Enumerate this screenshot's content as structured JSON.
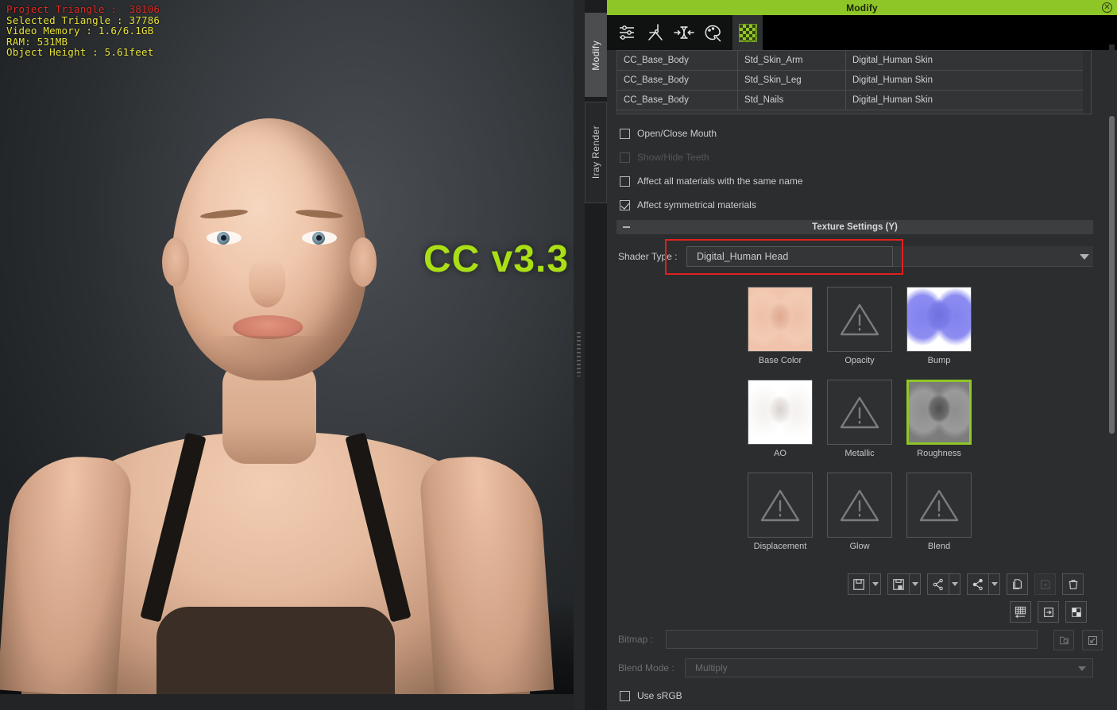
{
  "viewport": {
    "stats": {
      "project_triangle": "Project Triangle :  38106",
      "selected_triangle": "Selected Triangle : 37786",
      "video_memory": "Video Memory : 1.6/6.1GB",
      "ram": "RAM: 531MB",
      "object_height": "Object Height : 5.61feet"
    },
    "watermark": "CC v3.3",
    "colors": {
      "stats_red": "#e02b22",
      "stats_yellow": "#e8e43a",
      "watermark": "#aadf15"
    }
  },
  "vertical_tabs": [
    {
      "label": "Modify",
      "active": true
    },
    {
      "label": "Iray Render",
      "active": false
    }
  ],
  "panel": {
    "title": "Modify",
    "close_icon": "close-icon",
    "title_color": "#8ec628",
    "toolbar": {
      "icons": [
        {
          "name": "sliders-icon",
          "title": "Adjust"
        },
        {
          "name": "pose-icon",
          "title": "Pose"
        },
        {
          "name": "shape-icon",
          "title": "Shape"
        },
        {
          "name": "palette-icon",
          "title": "Appearance"
        }
      ],
      "active_tab": {
        "name": "material-checker-tab",
        "title": "Material"
      }
    },
    "material_table": {
      "rows": [
        {
          "object": "CC_Base_Body",
          "material": "Std_Skin_Arm",
          "shader": "Digital_Human Skin"
        },
        {
          "object": "CC_Base_Body",
          "material": "Std_Skin_Leg",
          "shader": "Digital_Human Skin"
        },
        {
          "object": "CC_Base_Body",
          "material": "Std_Nails",
          "shader": "Digital_Human Skin"
        }
      ]
    },
    "checkboxes": [
      {
        "label": "Open/Close Mouth",
        "checked": false,
        "disabled": false
      },
      {
        "label": "Show/Hide Teeth",
        "checked": false,
        "disabled": true
      },
      {
        "label": "Affect all materials with the same name",
        "checked": false,
        "disabled": false
      },
      {
        "label": "Affect symmetrical materials",
        "checked": true,
        "disabled": false
      }
    ],
    "texture_settings": {
      "header": "Texture Settings  (Y)",
      "collapse_icon": "minus-icon",
      "shader_type_label": "Shader Type :",
      "shader_type_value": "Digital_Human Head",
      "highlight_color": "#e02020",
      "slots": [
        {
          "label": "Base Color",
          "state": "filled",
          "style": "tx-base",
          "selected": false
        },
        {
          "label": "Opacity",
          "state": "empty",
          "style": "",
          "selected": false
        },
        {
          "label": "Bump",
          "state": "filled",
          "style": "tx-bump",
          "selected": false
        },
        {
          "label": "AO",
          "state": "filled",
          "style": "tx-ao",
          "selected": false
        },
        {
          "label": "Metallic",
          "state": "empty",
          "style": "",
          "selected": false
        },
        {
          "label": "Roughness",
          "state": "filled",
          "style": "tx-rough",
          "selected": true
        },
        {
          "label": "Displacement",
          "state": "empty",
          "style": "",
          "selected": false
        },
        {
          "label": "Glow",
          "state": "empty",
          "style": "",
          "selected": false
        },
        {
          "label": "Blend",
          "state": "empty",
          "style": "",
          "selected": false
        }
      ],
      "action_buttons_row1": [
        {
          "name": "save-button",
          "has_caret": true,
          "disabled": false
        },
        {
          "name": "save-as-button",
          "has_caret": true,
          "disabled": false
        },
        {
          "name": "share-button",
          "has_caret": true,
          "disabled": false
        },
        {
          "name": "share-all-button",
          "has_caret": true,
          "disabled": false
        },
        {
          "name": "copy-button",
          "has_caret": false,
          "disabled": false
        },
        {
          "name": "paste-button",
          "has_caret": false,
          "disabled": true
        },
        {
          "name": "delete-button",
          "has_caret": false,
          "disabled": false
        }
      ],
      "action_buttons_row2": [
        {
          "name": "uv-grid-button",
          "disabled": false
        },
        {
          "name": "import-button",
          "disabled": false
        },
        {
          "name": "checker-button",
          "disabled": false
        }
      ],
      "bitmap_label": "Bitmap :",
      "bitmap_value": "",
      "bitmap_browse_icon": "browse-icon",
      "bitmap_load_icon": "load-icon",
      "blend_mode_label": "Blend Mode :",
      "blend_mode_value": "Multiply",
      "use_srgb_label": "Use sRGB",
      "use_srgb_checked": false
    }
  }
}
